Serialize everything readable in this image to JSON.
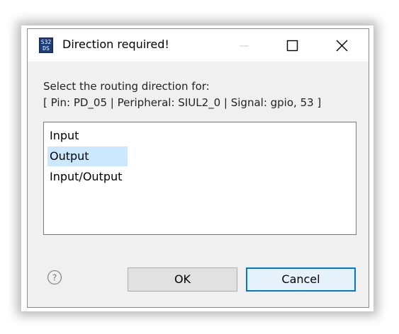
{
  "window": {
    "title": "Direction required!",
    "app_icon_text": "S32 DS"
  },
  "dialog": {
    "prompt": "Select the routing direction for:",
    "details": "[ Pin: PD_05 | Peripheral: SIUL2_0 | Signal: gpio, 53 ]",
    "list": {
      "items": [
        "Input",
        "Output",
        "Input/Output"
      ],
      "selected": "Output"
    }
  },
  "buttons": {
    "ok": "OK",
    "cancel": "Cancel"
  },
  "icons": {
    "app": "s32ds-logo-icon",
    "minimize": "minimize-icon",
    "maximize": "maximize-icon",
    "close": "close-icon",
    "help": "help-icon"
  },
  "colors": {
    "selection": "#cce8ff",
    "focus_border": "#0078d7",
    "dialog_bg": "#f0f0f0"
  }
}
